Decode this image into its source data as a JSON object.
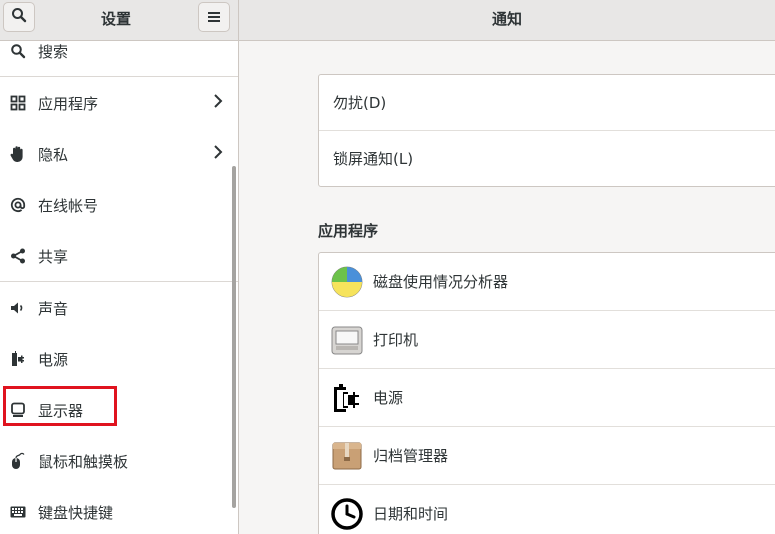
{
  "header": {
    "sidebar_title": "设置",
    "main_title": "通知",
    "search_button_icon": "search-icon",
    "menu_button_icon": "hamburger-menu-icon"
  },
  "sidebar": {
    "items": [
      {
        "label": "搜索",
        "icon": "search-icon"
      },
      {
        "label": "应用程序",
        "icon": "grid-icon",
        "has_submenu": true
      },
      {
        "label": "隐私",
        "icon": "hand-icon",
        "has_submenu": true
      },
      {
        "label": "在线帐号",
        "icon": "at-sign-icon"
      },
      {
        "label": "共享",
        "icon": "share-icon"
      },
      {
        "label": "声音",
        "icon": "speaker-icon"
      },
      {
        "label": "电源",
        "icon": "power-plug-icon"
      },
      {
        "label": "显示器",
        "icon": "monitor-icon",
        "highlighted": true
      },
      {
        "label": "鼠标和触摸板",
        "icon": "mouse-icon"
      },
      {
        "label": "键盘快捷键",
        "icon": "keyboard-icon"
      }
    ],
    "chevron": "›"
  },
  "main": {
    "general": [
      {
        "label": "勿扰(D)"
      },
      {
        "label": "锁屏通知(L)"
      }
    ],
    "section_title": "应用程序",
    "apps": [
      {
        "label": "磁盘使用情况分析器",
        "icon": "disk-usage-pie-icon"
      },
      {
        "label": "打印机",
        "icon": "printer-icon"
      },
      {
        "label": "电源",
        "icon": "battery-plug-icon"
      },
      {
        "label": "归档管理器",
        "icon": "archive-box-icon"
      },
      {
        "label": "日期和时间",
        "icon": "clock-icon"
      }
    ]
  },
  "colors": {
    "highlight_border": "#e0131f",
    "header_bg": "#e8e7e6",
    "window_bg": "#f6f5f4"
  }
}
